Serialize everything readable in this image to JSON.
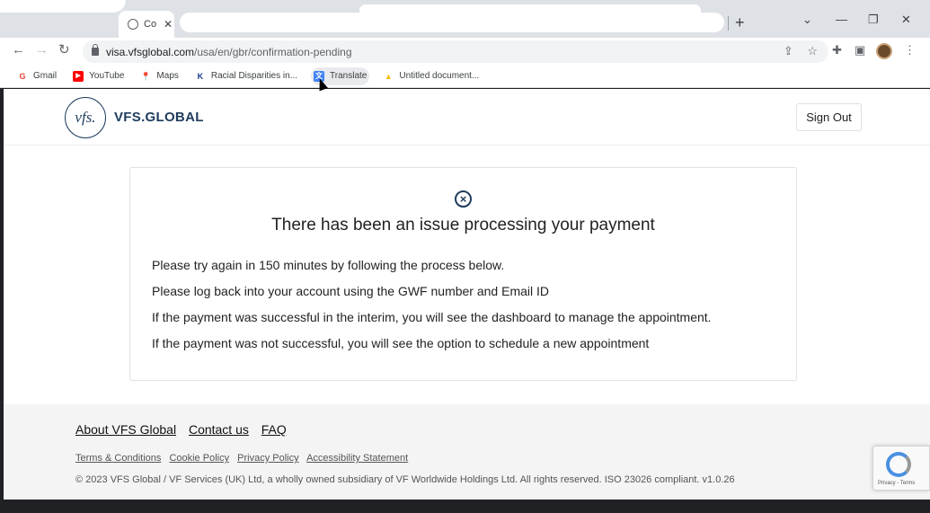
{
  "browser": {
    "tab_title": "Co",
    "tab_close": "✕",
    "new_tab": "+",
    "tab_menu": "⌄",
    "minimize": "—",
    "restore": "❐",
    "close": "✕",
    "back": "←",
    "forward": "→",
    "reload": "↻",
    "url_host": "visa.vfsglobal.com",
    "url_path": "/usa/en/gbr/confirmation-pending",
    "share_icon": "⇪",
    "star_icon": "☆",
    "extensions_icon": "✚",
    "sidepanel_icon": "▣",
    "menu_icon": "⋮"
  },
  "bookmarks": [
    {
      "label": "Gmail",
      "icon": "G",
      "color": "#ea4335"
    },
    {
      "label": "YouTube",
      "icon": "▶",
      "color": "#ff0000"
    },
    {
      "label": "Maps",
      "icon": "📍",
      "color": "#34a853"
    },
    {
      "label": "Racial Disparities in...",
      "icon": "K",
      "color": "#1a3c8c"
    },
    {
      "label": "Translate",
      "icon": "文",
      "color": "#4285f4"
    },
    {
      "label": "Untitled document...",
      "icon": "▲",
      "color": "#fbbc04"
    }
  ],
  "header": {
    "logo_mark": "vfs.",
    "logo_text": "VFS.GLOBAL",
    "sign_out": "Sign Out"
  },
  "card": {
    "icon": "×",
    "title": "There has been an issue processing your payment",
    "lines": [
      "Please try again in 150 minutes by following the process below.",
      "Please log back into your account using the GWF number and Email ID",
      "If the payment was successful in the interim, you will see the dashboard to manage the appointment.",
      "If the payment was not successful, you will see the option to schedule a new appointment"
    ]
  },
  "footer": {
    "links": [
      "About VFS Global",
      "Contact us",
      "FAQ"
    ],
    "legal": [
      "Terms & Conditions",
      "Cookie Policy",
      "Privacy Policy",
      "Accessibility Statement"
    ],
    "copyright": "© 2023 VFS Global / VF Services (UK) Ltd, a wholly owned subsidiary of VF Worldwide Holdings Ltd. All rights reserved. ISO 23026 compliant. v1.0.26"
  },
  "recaptcha": {
    "text": "Privacy - Terms"
  }
}
